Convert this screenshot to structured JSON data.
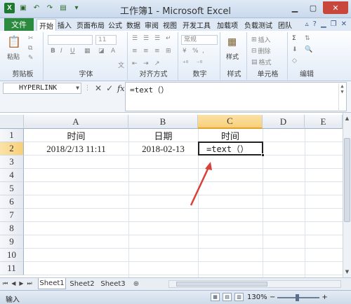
{
  "window": {
    "title": "工作簿1 - Microsoft Excel",
    "logo": "X",
    "controls": [
      "minimize-icon",
      "maximize-icon",
      "close-icon"
    ]
  },
  "ribbon_tabs": {
    "file": "文件",
    "items": [
      "开始",
      "插入",
      "页面布局",
      "公式",
      "数据",
      "审阅",
      "视图",
      "开发工具",
      "加载项",
      "负载测试",
      "团队"
    ],
    "active": "开始"
  },
  "ribbon": {
    "clipboard": {
      "paste": "粘贴",
      "label": "剪贴板"
    },
    "font": {
      "size": "11",
      "bold": "B",
      "italic": "I",
      "underline": "U",
      "font_color": "A",
      "wen": "文",
      "label": "字体"
    },
    "alignment": {
      "label": "对齐方式"
    },
    "number": {
      "format": "常规",
      "label": "数字",
      "percent": "%",
      "comma": ","
    },
    "styles": {
      "label": "样式"
    },
    "cells": {
      "insert": "插入",
      "delete": "删除",
      "format": "格式",
      "label": "单元格"
    },
    "editing": {
      "sum": "Σ",
      "label": "编辑"
    }
  },
  "formula_bar": {
    "name_box": "HYPERLINK",
    "cancel": "✕",
    "enter": "✓",
    "fx": "fx",
    "content": "=text（）"
  },
  "columns": [
    "A",
    "B",
    "C",
    "D",
    "E"
  ],
  "rows": [
    "1",
    "2",
    "3",
    "4",
    "5",
    "6",
    "7",
    "8",
    "9",
    "10",
    "11"
  ],
  "cells": {
    "A1": "时间",
    "B1": "日期",
    "C1": "时间",
    "A2": "2018/2/13  11:11",
    "B2": "2018-02-13",
    "C2": "=text（）"
  },
  "active_cell": "C2",
  "sheets": {
    "tabs": [
      "Sheet1",
      "Sheet2",
      "Sheet3"
    ],
    "active": "Sheet1"
  },
  "status_bar": {
    "mode": "输入",
    "zoom": "130%",
    "minus": "−",
    "plus": "+"
  },
  "colors": {
    "file_tab": "#2b8a3e",
    "selected_header": "#f8cf77",
    "arrow": "#d9403a",
    "close_button": "#c9463d"
  }
}
